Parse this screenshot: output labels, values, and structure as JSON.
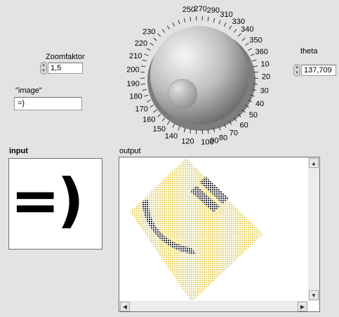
{
  "zoom": {
    "label": "Zoomfaktor",
    "value": "1,5"
  },
  "image_ctl": {
    "label": "\"image\"",
    "value": "=)"
  },
  "theta": {
    "label": "theta",
    "value": "137,709"
  },
  "dial": {
    "labels": [
      "250",
      "270",
      "290",
      "310",
      "330",
      "340",
      "350",
      "360",
      "10",
      "20",
      "30",
      "40",
      "50",
      "60",
      "70",
      "80",
      "90",
      "100",
      "120",
      "140",
      "150",
      "160",
      "170",
      "180",
      "190",
      "200",
      "210",
      "220",
      "230"
    ],
    "value_degrees": 137.709
  },
  "input_panel": {
    "label": "input",
    "text": "=)"
  },
  "output_panel": {
    "label": "output"
  },
  "icons": {
    "spin_up": "▲",
    "spin_down": "▼",
    "scroll_up": "▲",
    "scroll_down": "▼",
    "scroll_left": "◀",
    "scroll_right": "▶"
  }
}
